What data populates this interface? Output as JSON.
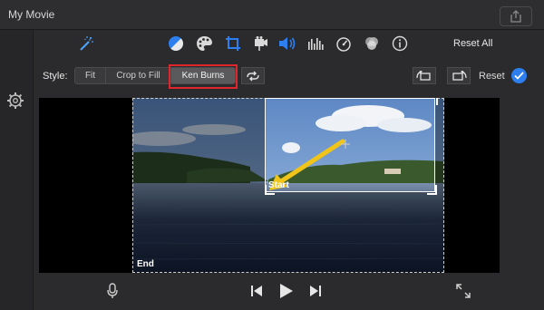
{
  "titlebar": {
    "title": "My Movie",
    "share_icon": "share-icon"
  },
  "toolbar": {
    "icons": [
      "magic-wand-icon",
      "color-balance-icon",
      "color-palette-icon",
      "crop-icon",
      "stabilization-icon",
      "volume-icon",
      "equalizer-icon",
      "speed-icon",
      "filter-icon",
      "info-icon"
    ],
    "reset_all_label": "Reset All",
    "active_tool": "crop-icon",
    "accent_color": "#2d7ff0"
  },
  "style_bar": {
    "label": "Style:",
    "options": [
      "Fit",
      "Crop to Fill",
      "Ken Burns"
    ],
    "selected": "Ken Burns",
    "reset_label": "Reset"
  },
  "viewer": {
    "start_label": "Start",
    "end_label": "End"
  },
  "highlight_color": "#e0262b"
}
